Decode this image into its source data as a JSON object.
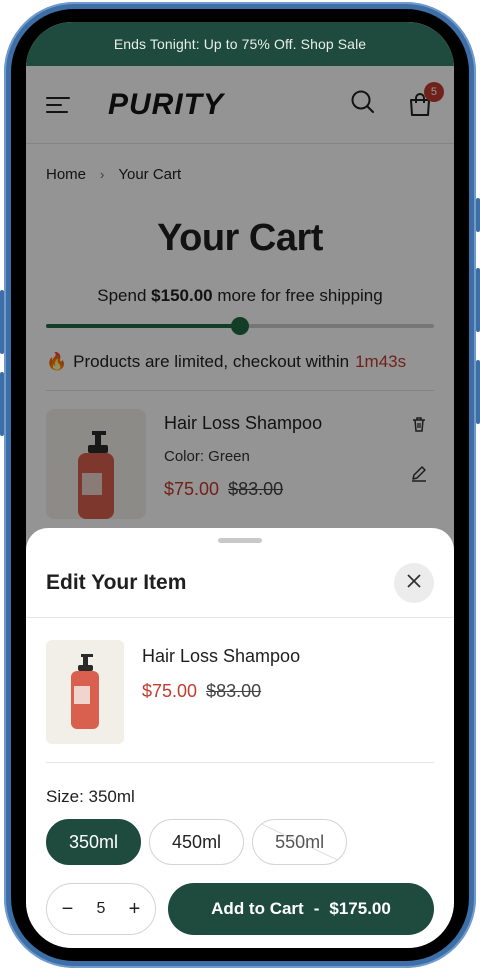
{
  "announcement": "Ends Tonight: Up to 75% Off. Shop Sale",
  "header": {
    "logo": "PURITY",
    "cart_count": "5"
  },
  "breadcrumb": {
    "home": "Home",
    "separator": "›",
    "current": "Your Cart"
  },
  "page_title": "Your Cart",
  "shipping": {
    "prefix": "Spend",
    "amount": "$150.00",
    "suffix": "more for free shipping",
    "progress_fraction": 0.5
  },
  "limited": {
    "icon": "🔥",
    "text": "Products are limited, checkout within",
    "timer": "1m43s"
  },
  "cart_item": {
    "name": "Hair Loss Shampoo",
    "color": "Color: Green",
    "price": "$75.00",
    "old_price": "$83.00"
  },
  "sheet": {
    "title": "Edit Your Item",
    "product_name": "Hair Loss Shampoo",
    "price": "$75.00",
    "old_price": "$83.00",
    "size_label": "Size: 350ml",
    "sizes": [
      "350ml",
      "450ml",
      "550ml"
    ],
    "quantity": "5",
    "minus": "−",
    "plus": "+",
    "add_label": "Add to Cart",
    "add_sep": "-",
    "add_total": "$175.00"
  },
  "colors": {
    "brand_green": "#1f4a3e",
    "sale_red": "#c23b2e"
  }
}
